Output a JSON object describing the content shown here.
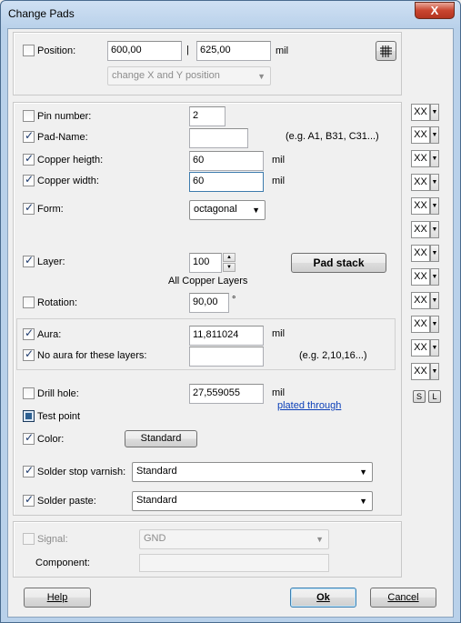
{
  "window": {
    "title": "Change Pads",
    "close_label": "X"
  },
  "position": {
    "label": "Position:",
    "x": "600,00",
    "separator": "|",
    "y": "625,00",
    "unit": "mil",
    "mode": "change X and Y position",
    "grid_icon": "grid-icon"
  },
  "fields": {
    "pin_number": {
      "label": "Pin number:",
      "value": "2"
    },
    "pad_name": {
      "label": "Pad-Name:",
      "value": "",
      "hint": "(e.g. A1, B31, C31...)"
    },
    "copper_height": {
      "label": "Copper heigth:",
      "value": "60",
      "unit": "mil"
    },
    "copper_width": {
      "label": "Copper width:",
      "value": "60",
      "unit": "mil"
    },
    "form": {
      "label": "Form:",
      "value": "octagonal"
    },
    "layer": {
      "label": "Layer:",
      "value": "100",
      "caption": "All Copper Layers",
      "pad_stack_label": "Pad stack"
    },
    "rotation": {
      "label": "Rotation:",
      "value": "90,00",
      "unit": "°"
    },
    "aura": {
      "label": "Aura:",
      "value": "11,811024",
      "unit": "mil"
    },
    "no_aura": {
      "label": "No aura for these layers:",
      "value": "",
      "hint": "(e.g. 2,10,16...)"
    },
    "drill_hole": {
      "label": "Drill hole:",
      "value": "27,559055",
      "unit": "mil",
      "link": "plated through"
    },
    "test_point": {
      "label": "Test point"
    },
    "color": {
      "label": "Color:",
      "button": "Standard"
    },
    "solder_stop": {
      "label": "Solder stop varnish:",
      "value": "Standard"
    },
    "solder_paste": {
      "label": "Solder paste:",
      "value": "Standard"
    }
  },
  "side": {
    "xx_label": "XX",
    "s_label": "S",
    "l_label": "L"
  },
  "signal": {
    "label": "Signal:",
    "value": "GND",
    "component_label": "Component:"
  },
  "footer": {
    "help": "Help",
    "ok": "Ok",
    "cancel": "Cancel"
  }
}
